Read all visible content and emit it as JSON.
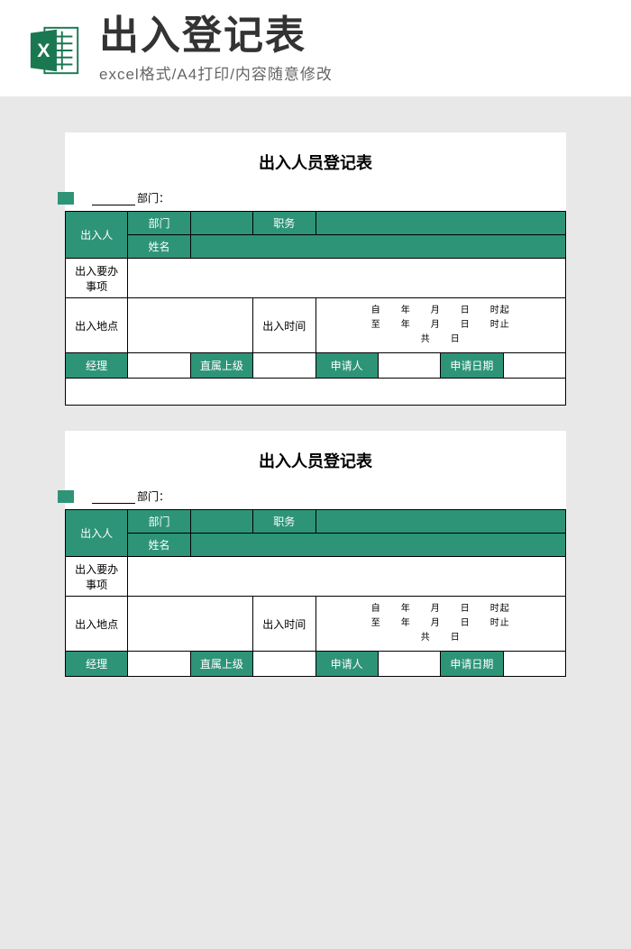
{
  "header": {
    "title": "出入登记表",
    "subtitle": "excel格式/A4打印/内容随意修改",
    "icon_letter": "X"
  },
  "form": {
    "title": "出入人员登记表",
    "dept_label": "部门：",
    "person_label": "出入人",
    "dept": "部门",
    "position": "职务",
    "name": "姓名",
    "matters": "出入要办",
    "matters2": "事项",
    "location": "出入地点",
    "time": "出入时间",
    "time_line1": "自　　年　　月　　日　　时起",
    "time_line2": "至　　年　　月　　日　　时止",
    "time_line3": "共　　日",
    "manager": "经理",
    "supervisor": "直属上级",
    "applicant": "申请人",
    "apply_date": "申请日期"
  }
}
